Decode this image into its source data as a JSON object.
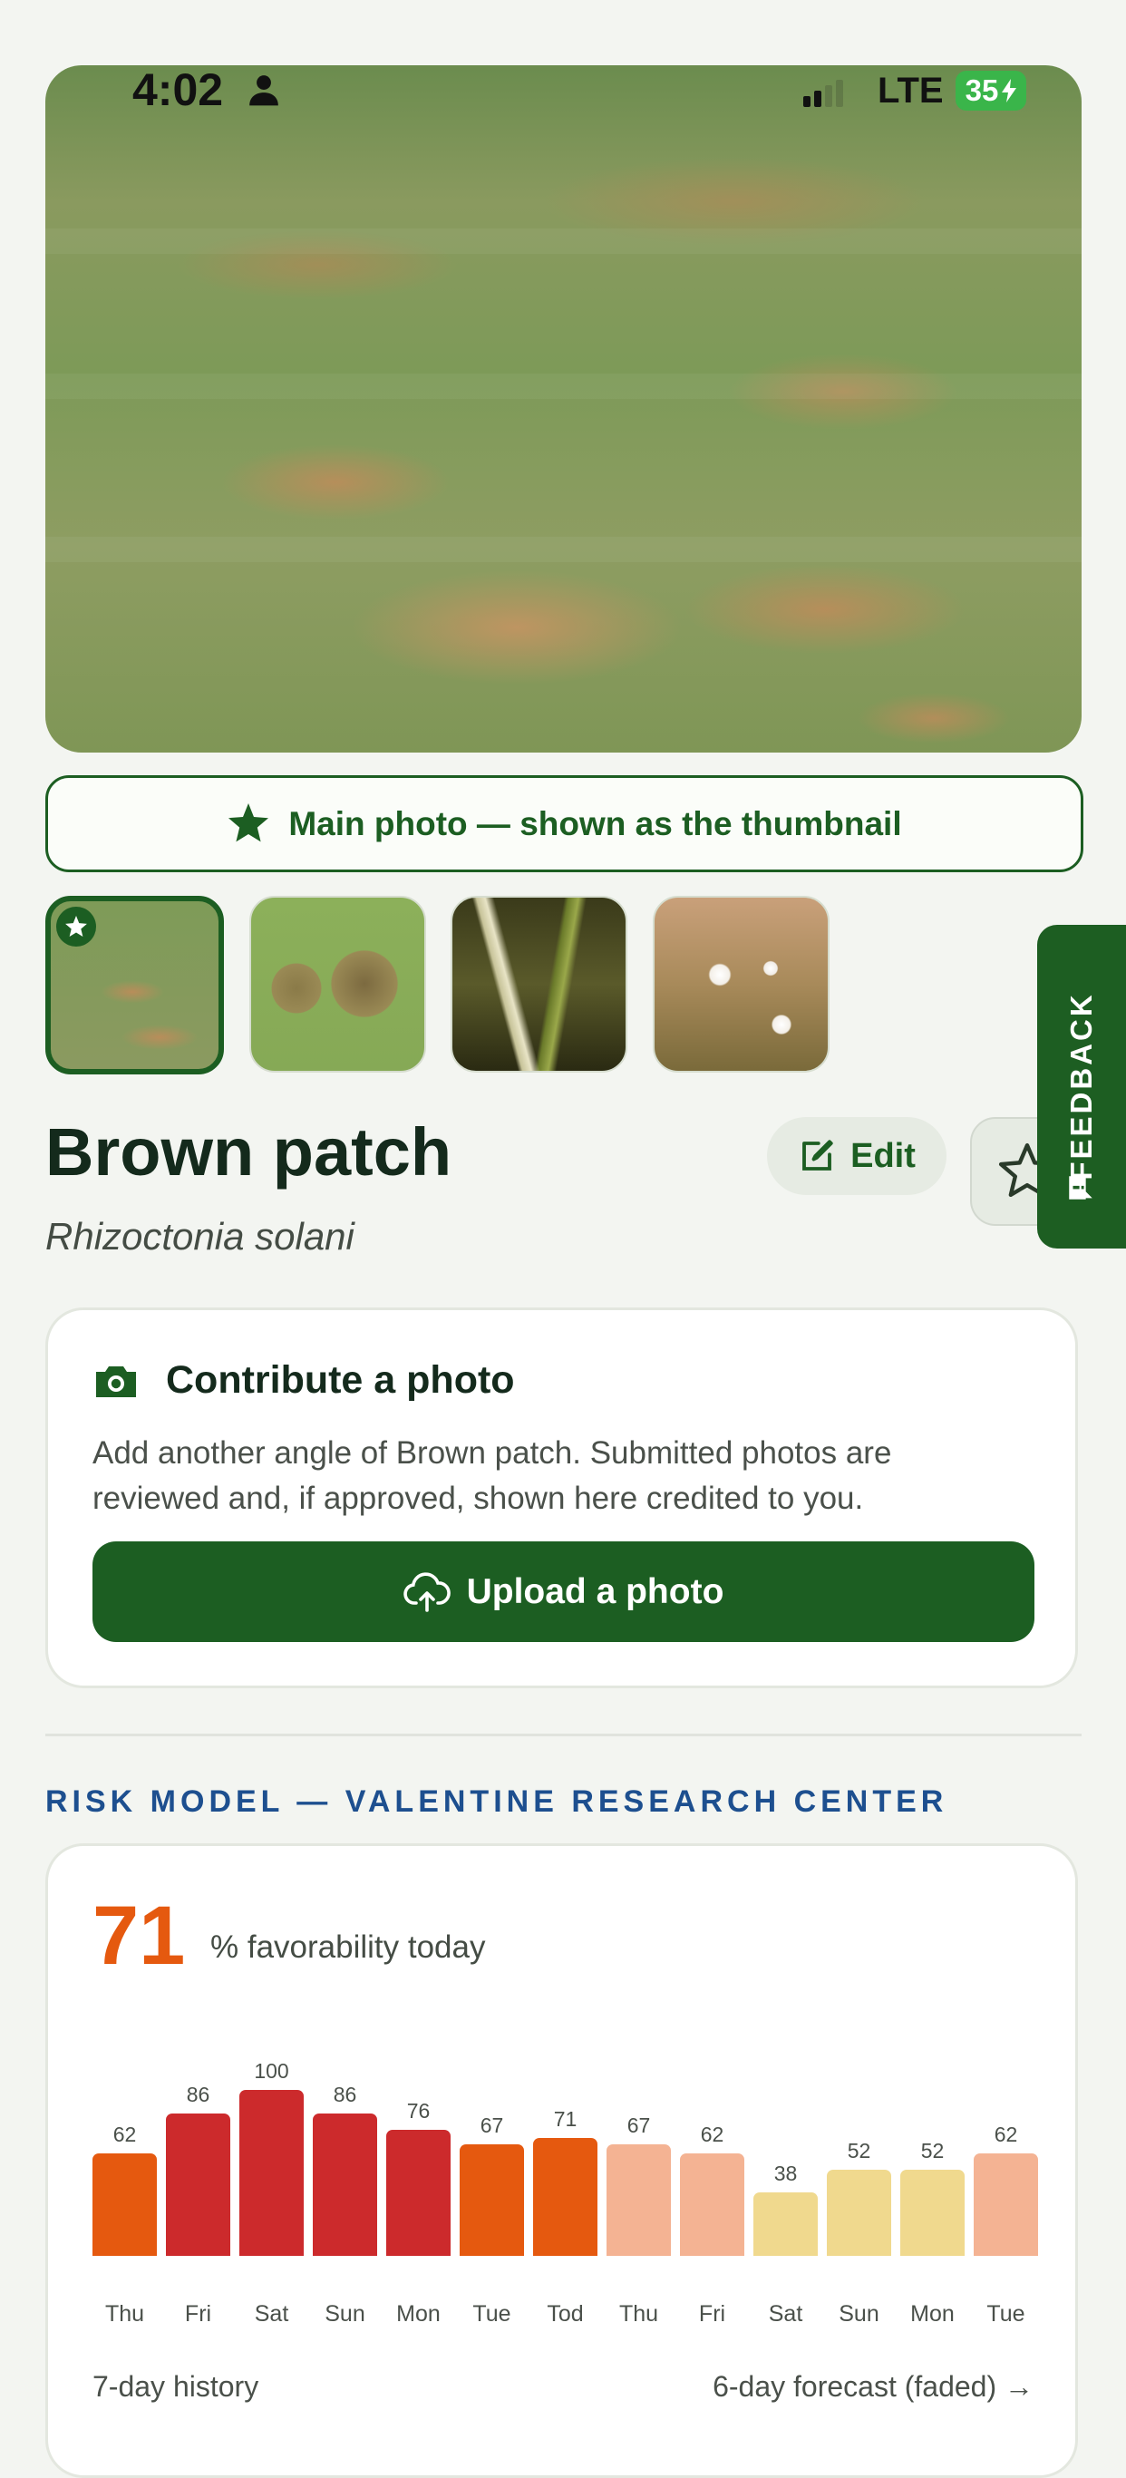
{
  "status": {
    "time": "4:02",
    "network": "LTE",
    "battery": "35"
  },
  "banner": {
    "label": "Main photo — shown as the thumbnail"
  },
  "thumbnails": [
    {
      "name": "thumb-1",
      "selected": true
    },
    {
      "name": "thumb-2",
      "selected": false
    },
    {
      "name": "thumb-3",
      "selected": false
    },
    {
      "name": "thumb-4",
      "selected": false
    }
  ],
  "disease": {
    "title": "Brown patch",
    "scientific": "Rhizoctonia solani"
  },
  "actions": {
    "edit": "Edit"
  },
  "feedback": {
    "label": "FEEDBACK"
  },
  "contribute": {
    "title": "Contribute a photo",
    "body": "Add another angle of Brown patch. Submitted photos are reviewed and, if approved, shown here credited to you.",
    "upload": "Upload a photo"
  },
  "risk": {
    "heading": "RISK MODEL — VALENTINE RESEARCH CENTER",
    "value": "71",
    "label": "% favorability today",
    "history_label": "7-day history",
    "forecast_label": "6-day forecast (faded) →"
  },
  "colors": {
    "brand_green": "#1c5e22",
    "risk_orange": "#e5590f",
    "risk_red": "#cc2a2c",
    "faded_orange": "#f4b393",
    "faded_yellow": "#f0d98e",
    "heading_blue": "#1d4f8f"
  },
  "chart_data": {
    "type": "bar",
    "categories": [
      "Thu",
      "Fri",
      "Sat",
      "Sun",
      "Mon",
      "Tue",
      "Tod",
      "Thu",
      "Fri",
      "Sat",
      "Sun",
      "Mon",
      "Tue"
    ],
    "values": [
      62,
      86,
      100,
      86,
      76,
      67,
      71,
      67,
      62,
      38,
      52,
      52,
      62
    ],
    "bar_colors": [
      "#e5590f",
      "#cc2a2c",
      "#cc2a2c",
      "#cc2a2c",
      "#cc2a2c",
      "#e5590f",
      "#e5590f",
      "#f4b393",
      "#f4b393",
      "#f0d98e",
      "#f0d98e",
      "#f0d98e",
      "#f4b393"
    ],
    "ylim": [
      0,
      100
    ]
  }
}
